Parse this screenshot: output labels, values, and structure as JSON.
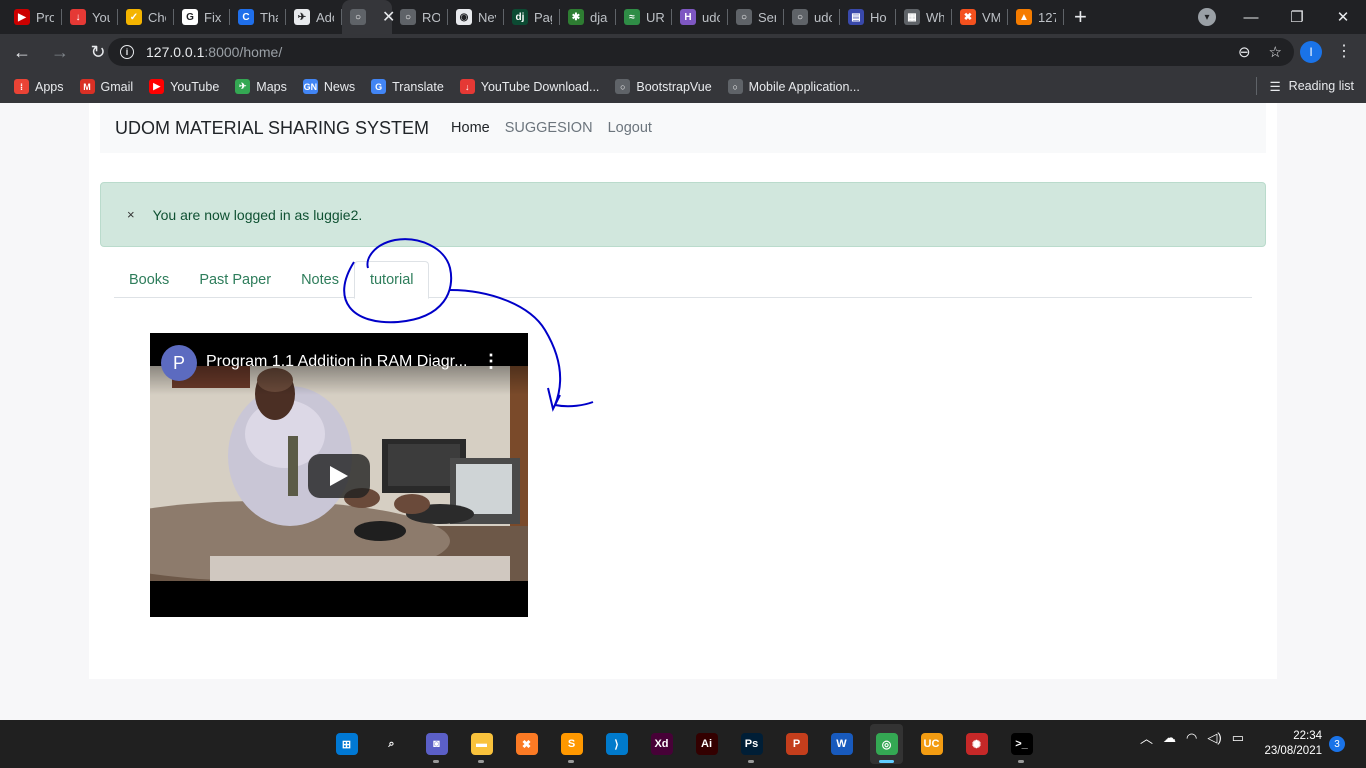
{
  "browser": {
    "tabs": [
      {
        "title": "Pro",
        "color": "#cc0000",
        "glyph": "▶"
      },
      {
        "title": "You",
        "color": "#e53935",
        "glyph": "↓"
      },
      {
        "title": "Che",
        "color": "#f4b400",
        "glyph": "✓"
      },
      {
        "title": "Fix",
        "color": "#ffffff",
        "glyph": "G"
      },
      {
        "title": "Tha",
        "color": "#1f6feb",
        "glyph": "C"
      },
      {
        "title": "Adc",
        "color": "#e8eaed",
        "glyph": "✈"
      },
      {
        "title": "",
        "color": "#5f6368",
        "glyph": "○",
        "active": true
      },
      {
        "title": "RO!",
        "color": "#5f6368",
        "glyph": "○"
      },
      {
        "title": "Nev",
        "color": "#e8eaed",
        "glyph": "◉"
      },
      {
        "title": "Pag",
        "color": "#0c4b33",
        "glyph": "dj"
      },
      {
        "title": "dja",
        "color": "#2e7d32",
        "glyph": "✱"
      },
      {
        "title": "URI",
        "color": "#2f8d46",
        "glyph": "≈"
      },
      {
        "title": "udc",
        "color": "#7e57c2",
        "glyph": "H"
      },
      {
        "title": "Ser",
        "color": "#5f6368",
        "glyph": "○"
      },
      {
        "title": "udc",
        "color": "#5f6368",
        "glyph": "○"
      },
      {
        "title": "Ho",
        "color": "#3949ab",
        "glyph": "▤"
      },
      {
        "title": "Wh",
        "color": "#5f6368",
        "glyph": "▦"
      },
      {
        "title": "VM",
        "color": "#f4511e",
        "glyph": "✖"
      },
      {
        "title": "127",
        "color": "#f57c00",
        "glyph": "▲"
      }
    ],
    "url_host": "127.0.0.1",
    "url_rest": ":8000/home/",
    "profile_initial": "I",
    "bookmarks": [
      {
        "label": "Apps",
        "color": "#ea4335",
        "glyph": "⁞"
      },
      {
        "label": "Gmail",
        "color": "#d93025",
        "glyph": "M"
      },
      {
        "label": "YouTube",
        "color": "#ff0000",
        "glyph": "▶"
      },
      {
        "label": "Maps",
        "color": "#34a853",
        "glyph": "✈"
      },
      {
        "label": "News",
        "color": "#4285f4",
        "glyph": "GN"
      },
      {
        "label": "Translate",
        "color": "#4285f4",
        "glyph": "G"
      },
      {
        "label": "YouTube Download...",
        "color": "#e53935",
        "glyph": "↓"
      },
      {
        "label": "BootstrapVue",
        "color": "#5f6368",
        "glyph": "○"
      },
      {
        "label": "Mobile Application...",
        "color": "#5f6368",
        "glyph": "○"
      }
    ],
    "reading_list": "Reading list"
  },
  "page": {
    "brand": "UDOM MATERIAL SHARING SYSTEM",
    "nav": [
      "Home",
      "SUGGESION",
      "Logout"
    ],
    "alert_close": "×",
    "alert_text": "You are now logged in as luggie2.",
    "tabs": [
      "Books",
      "Past Paper",
      "Notes",
      "tutorial"
    ],
    "video": {
      "channel_initial": "P",
      "title": "Program 1.1 Addition in RAM Diagr..."
    }
  },
  "taskbar": {
    "apps": [
      {
        "name": "start",
        "color": "#0078d4",
        "glyph": "⊞"
      },
      {
        "name": "search",
        "color": "#202020",
        "glyph": "⌕"
      },
      {
        "name": "chat",
        "color": "#5b5fc7",
        "glyph": "◙"
      },
      {
        "name": "file-explorer",
        "color": "#f9c23c",
        "glyph": "▬"
      },
      {
        "name": "xampp",
        "color": "#fb7a24",
        "glyph": "✖"
      },
      {
        "name": "sublime",
        "color": "#ff9800",
        "glyph": "S"
      },
      {
        "name": "vscode",
        "color": "#007acc",
        "glyph": "⟩"
      },
      {
        "name": "adobe-xd",
        "color": "#470137",
        "glyph": "Xd"
      },
      {
        "name": "illustrator",
        "color": "#330000",
        "glyph": "Ai"
      },
      {
        "name": "photoshop",
        "color": "#001e36",
        "glyph": "Ps"
      },
      {
        "name": "powerpoint",
        "color": "#c43e1c",
        "glyph": "P"
      },
      {
        "name": "word",
        "color": "#185abd",
        "glyph": "W"
      },
      {
        "name": "chrome",
        "color": "#34a853",
        "glyph": "◎"
      },
      {
        "name": "uc-browser",
        "color": "#f39c12",
        "glyph": "UC"
      },
      {
        "name": "antivirus",
        "color": "#c62828",
        "glyph": "✺"
      },
      {
        "name": "terminal",
        "color": "#000000",
        "glyph": ">_"
      }
    ],
    "time": "22:34",
    "date": "23/08/2021",
    "notifications": "3"
  }
}
